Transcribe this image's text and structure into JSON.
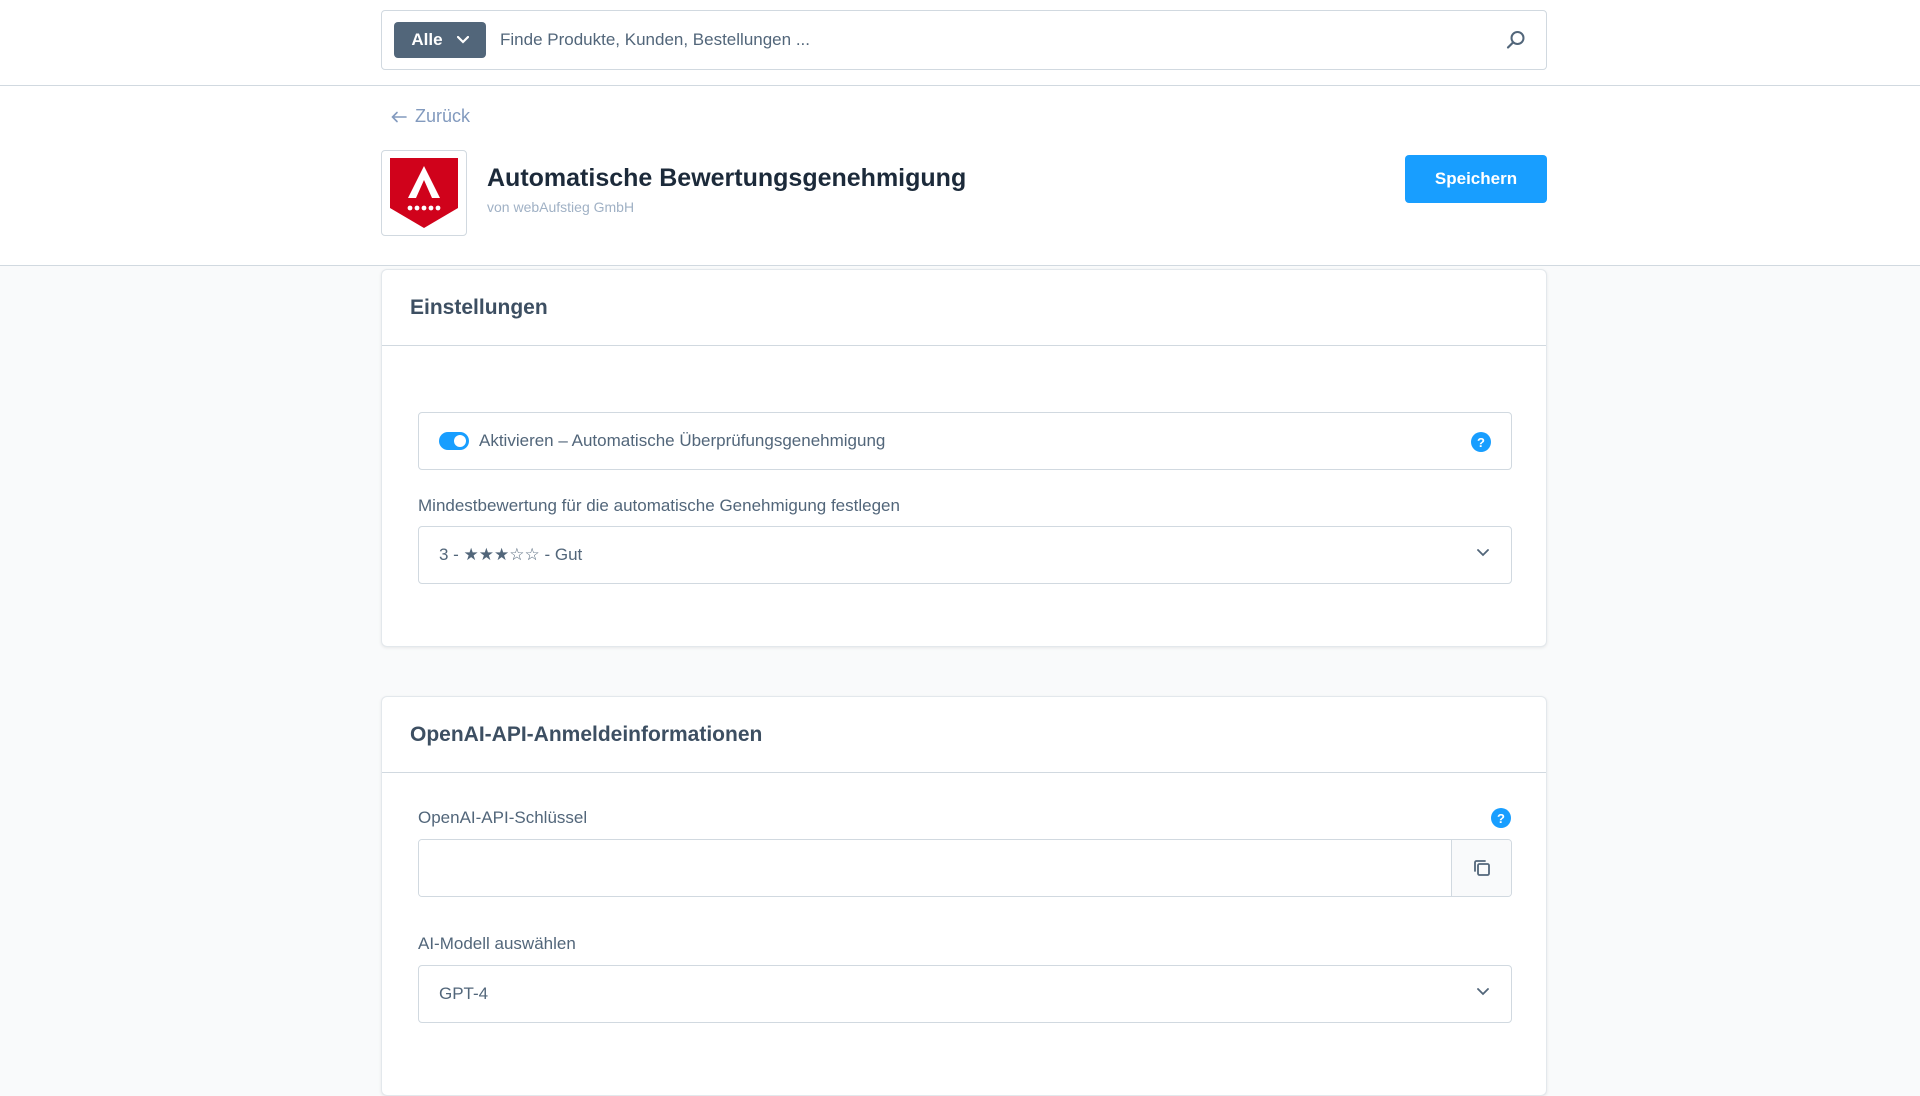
{
  "search": {
    "type_label": "Alle",
    "placeholder": "Finde Produkte, Kunden, Bestellungen ..."
  },
  "header": {
    "back_label": "Zurück",
    "app_title": "Automatische Bewertungsgenehmigung",
    "app_vendor": "von webAufstieg GmbH",
    "save_label": "Speichern"
  },
  "settings": {
    "title": "Einstellungen",
    "toggle_label": "Aktivieren – Automatische Überprüfungsgenehmigung",
    "toggle_on": true,
    "min_rating_label": "Mindestbewertung für die automatische Genehmigung festlegen",
    "min_rating_value": "3 - ★★★☆☆ - Gut"
  },
  "openai": {
    "title": "OpenAI-API-Anmeldeinformationen",
    "api_key_label": "OpenAI-API-Schlüssel",
    "api_key_value": "",
    "model_label": "AI-Modell auswählen",
    "model_value": "GPT-4"
  },
  "colors": {
    "primary": "#189eff",
    "logo_red": "#d0021b",
    "text": "#52667a"
  }
}
